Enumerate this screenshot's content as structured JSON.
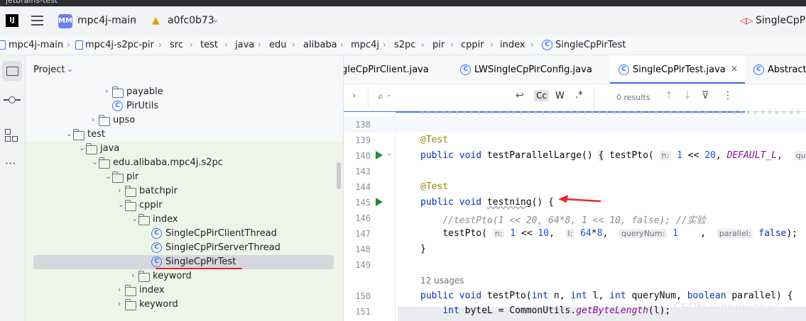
{
  "window": {
    "title": "jetbrains-test"
  },
  "toolbar": {
    "project_badge": "MM",
    "project_name": "mpc4j-main",
    "branch": "a0fc0b73",
    "run_config": "SingleCpPir"
  },
  "breadcrumb": [
    "mpc4j-main",
    "mpc4j-s2pc-pir",
    "src",
    "test",
    "java",
    "edu",
    "alibaba",
    "mpc4j",
    "s2pc",
    "pir",
    "cppir",
    "index",
    "SingleCpPirTest"
  ],
  "project_panel": {
    "title": "Project",
    "tree": [
      {
        "label": "payable",
        "type": "folder",
        "depth": 4,
        "arrow": "›"
      },
      {
        "label": "PirUtils",
        "type": "class",
        "depth": 4,
        "arrow": ""
      },
      {
        "label": "upso",
        "type": "folder",
        "depth": 3,
        "arrow": "›"
      },
      {
        "label": "test",
        "type": "folder",
        "depth": 1,
        "arrow": "⌄"
      },
      {
        "label": "java",
        "type": "folder",
        "depth": 2,
        "arrow": "⌄"
      },
      {
        "label": "edu.alibaba.mpc4j.s2pc",
        "type": "folder",
        "depth": 3,
        "arrow": "⌄"
      },
      {
        "label": "pir",
        "type": "folder",
        "depth": 4,
        "arrow": "⌄"
      },
      {
        "label": "batchpir",
        "type": "folder",
        "depth": 5,
        "arrow": "›"
      },
      {
        "label": "cppir",
        "type": "folder",
        "depth": 5,
        "arrow": "⌄"
      },
      {
        "label": "index",
        "type": "folder",
        "depth": 6,
        "arrow": "⌄"
      },
      {
        "label": "SingleCpPirClientThread",
        "type": "class",
        "depth": 7,
        "arrow": ""
      },
      {
        "label": "SingleCpPirServerThread",
        "type": "class",
        "depth": 7,
        "arrow": ""
      },
      {
        "label": "SingleCpPirTest",
        "type": "class",
        "depth": 7,
        "arrow": "",
        "selected": true
      },
      {
        "label": "keyword",
        "type": "folder",
        "depth": 6,
        "arrow": "›"
      },
      {
        "label": "index",
        "type": "folder",
        "depth": 5,
        "arrow": "›"
      },
      {
        "label": "keyword",
        "type": "folder",
        "depth": 5,
        "arrow": "›"
      }
    ]
  },
  "tabs": [
    {
      "label": "gleCpPirClient.java",
      "active": false
    },
    {
      "label": "LWSingleCpPirConfig.java",
      "active": false
    },
    {
      "label": "SingleCpPirTest.java",
      "active": true
    },
    {
      "label": "Abstract",
      "active": false
    }
  ],
  "search": {
    "results": "0 results",
    "case_label": "Cc",
    "word_label": "W",
    "regex_label": ".*"
  },
  "code": {
    "line_numbers": [
      "138",
      "139",
      "140",
      "143",
      "144",
      "145",
      "146",
      "147",
      "148",
      "149",
      "150",
      "151"
    ],
    "annotation": "@Test",
    "usages": "12 usages"
  },
  "watermark": "CSDN @nnloveswc",
  "colors": {
    "accent": "#3574f0",
    "selection": "#d5d7dc",
    "run_green": "#208a3c",
    "red_arrow": "#e8262b"
  }
}
